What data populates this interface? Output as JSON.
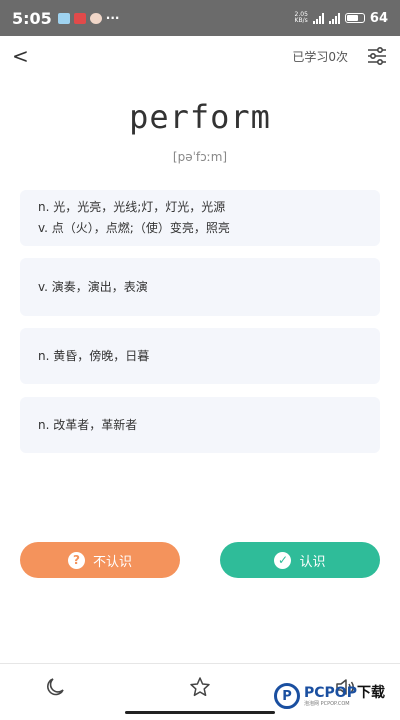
{
  "status_bar": {
    "time": "5:05",
    "network_speed_top": "2.05",
    "network_speed_unit": "KB/s",
    "battery_level": "64"
  },
  "header": {
    "back_glyph": "<",
    "study_count": "已学习0次"
  },
  "word": {
    "text": "perform",
    "phonetic": "[pəˈfɔːm]"
  },
  "definitions": [
    {
      "lines": [
        "n. 光，光亮，光线;灯，灯光，光源",
        "v. 点（火），点燃;（使）变亮，照亮"
      ]
    },
    {
      "lines": [
        "v. 演奏，演出，表演"
      ]
    },
    {
      "lines": [
        "n. 黄昏，傍晚，日暮"
      ]
    },
    {
      "lines": [
        "n. 改革者，革新者"
      ]
    }
  ],
  "buttons": {
    "unknown_label": "不认识",
    "known_label": "认识"
  },
  "watermark": {
    "logo_letter": "P",
    "brand": "PCPOP",
    "brand_suffix": "下载",
    "sub": "泡泡网 PCPOP.COM"
  },
  "colors": {
    "unknown_button": "#f4935c",
    "known_button": "#2fbc99",
    "card_background": "#f4f6fb"
  },
  "icons": {
    "header_right": "settings-sliders-icon",
    "bottom": [
      "moon-icon",
      "star-icon",
      "speaker-icon"
    ]
  }
}
